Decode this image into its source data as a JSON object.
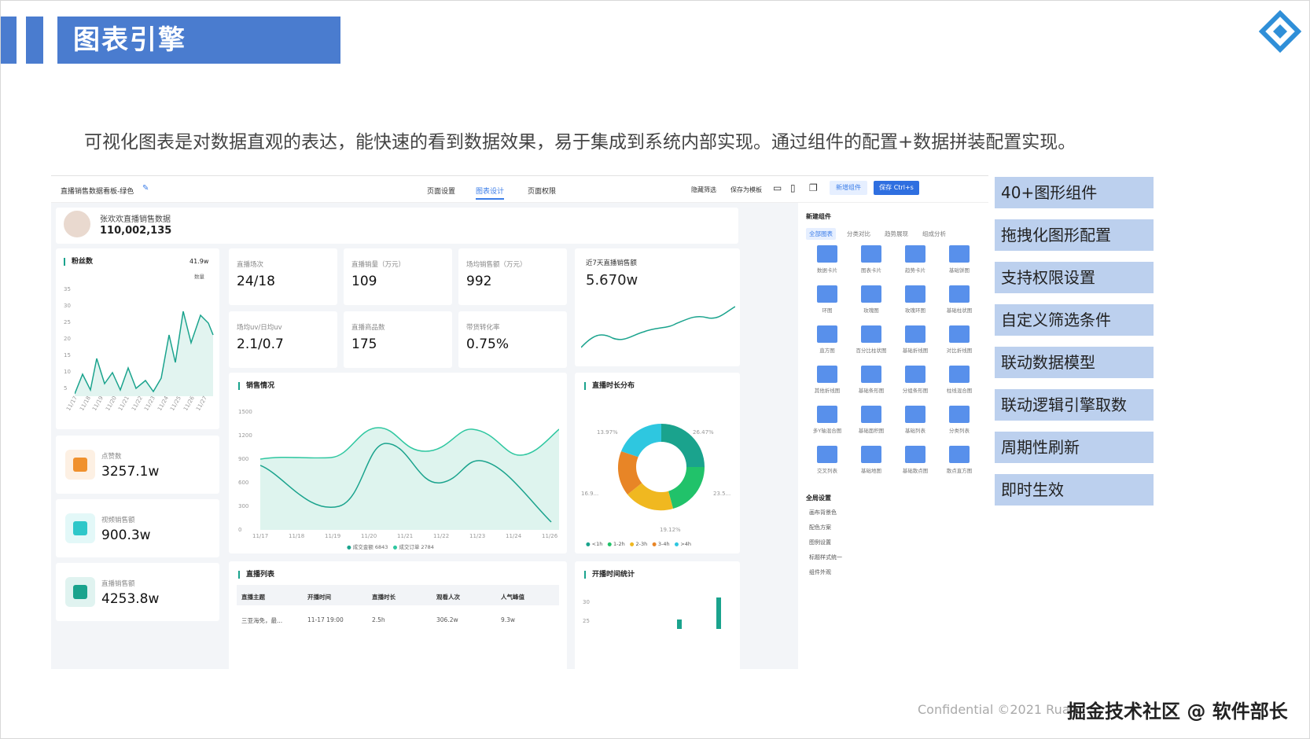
{
  "slide": {
    "title": "图表引擎",
    "intro": "可视化图表是对数据直观的表达，能快速的看到数据效果，易于集成到系统内部实现。通过组件的配置+数据拼装配置实现。",
    "footer": "Confidential ©2021 Ruan",
    "watermark": "掘金技术社区 @ 软件部长",
    "features": [
      "40+图形组件",
      "拖拽化图形配置",
      "支持权限设置",
      "自定义筛选条件",
      "联动数据模型",
      "联动逻辑引擎取数",
      "周期性刷新",
      "即时生效"
    ]
  },
  "app": {
    "board_title": "直播销售数据看板-绿色",
    "tabs": [
      "页面设置",
      "图表设计",
      "页面权限"
    ],
    "active_tab": "图表设计",
    "actions": [
      "隐藏筛选",
      "保存为模板"
    ],
    "add_button": "新增组件",
    "save_button": "保存 Ctrl+s",
    "profile": {
      "name": "张欢欢直播销售数据",
      "value": "110,002,135"
    },
    "fans": {
      "title": "粉丝数",
      "value": "41.9w",
      "legend": "数量",
      "y_ticks": [
        "35",
        "30",
        "25",
        "20",
        "15",
        "10",
        "5"
      ],
      "x_ticks": [
        "11/17",
        "11/18",
        "11/19",
        "11/20",
        "11/21",
        "11/22",
        "11/23",
        "11/24",
        "11/25",
        "11/26",
        "11/27"
      ]
    },
    "stats": [
      {
        "label": "直播场次",
        "value": "24/18"
      },
      {
        "label": "直播销量（万元）",
        "value": "109"
      },
      {
        "label": "场均销售额（万元）",
        "value": "992"
      },
      {
        "label": "场均uv/日均uv",
        "value": "2.1/0.7"
      },
      {
        "label": "直播商品数",
        "value": "175"
      },
      {
        "label": "带货转化率",
        "value": "0.75%"
      }
    ],
    "week_sales": {
      "label": "近7天直播销售额",
      "value": "5.670w"
    },
    "side_stats": [
      {
        "label": "点赞数",
        "value": "3257.1w",
        "color": "#f0912e"
      },
      {
        "label": "视频销售额",
        "value": "900.3w",
        "color": "#2ec7c9"
      },
      {
        "label": "直播销售额",
        "value": "4253.8w",
        "color": "#1aa38d"
      }
    ],
    "sales_chart": {
      "title": "销售情况",
      "y_ticks": [
        "1500",
        "1200",
        "900",
        "600",
        "300",
        "0"
      ],
      "x_ticks": [
        "11/17",
        "11/18",
        "11/19",
        "11/20",
        "11/21",
        "11/22",
        "11/23",
        "11/24",
        "11/26"
      ],
      "legend": [
        "成交金额 6843",
        "成交订单 2784"
      ]
    },
    "duration_chart": {
      "title": "直播时长分布",
      "labels": [
        "13.97%",
        "26.47%",
        "16.9...",
        "23.5...",
        "19.12%"
      ],
      "legend": [
        "<1h",
        "1-2h",
        "2-3h",
        "3-4h",
        ">4h"
      ],
      "colors": [
        "#1aa38d",
        "#21c26a",
        "#f0b820",
        "#e88526",
        "#2ec7e0"
      ]
    },
    "live_list": {
      "title": "直播列表",
      "columns": [
        "直播主题",
        "开播时间",
        "直播时长",
        "观看人次",
        "人气峰值"
      ],
      "rows": [
        [
          "三亚海免，最...",
          "11-17 19:00",
          "2.5h",
          "306.2w",
          "9.3w"
        ]
      ]
    },
    "open_time": {
      "title": "开播时间统计",
      "y_ticks": [
        "30",
        "25"
      ]
    },
    "panel": {
      "title": "新建组件",
      "tabs": [
        "全部图表",
        "分类对比",
        "趋势展现",
        "组成分析"
      ],
      "widgets": [
        "数据卡片",
        "图表卡片",
        "趋势卡片",
        "基础饼图",
        "环图",
        "玫瑰图",
        "玫瑰环图",
        "基础柱状图",
        "直方图",
        "百分比柱状图",
        "基础折线图",
        "对比折线图",
        "其他折线图",
        "基础条形图",
        "分组条形图",
        "柱线混合图",
        "多Y轴混合图",
        "基础面积图",
        "基础列表",
        "分类列表",
        "交叉列表",
        "基础地图",
        "基础散点图",
        "散点直方图"
      ],
      "sections": [
        "全局设置",
        "画布背景色",
        "配色方案",
        "图例设置",
        "标题样式统一",
        "组件外观"
      ]
    }
  }
}
